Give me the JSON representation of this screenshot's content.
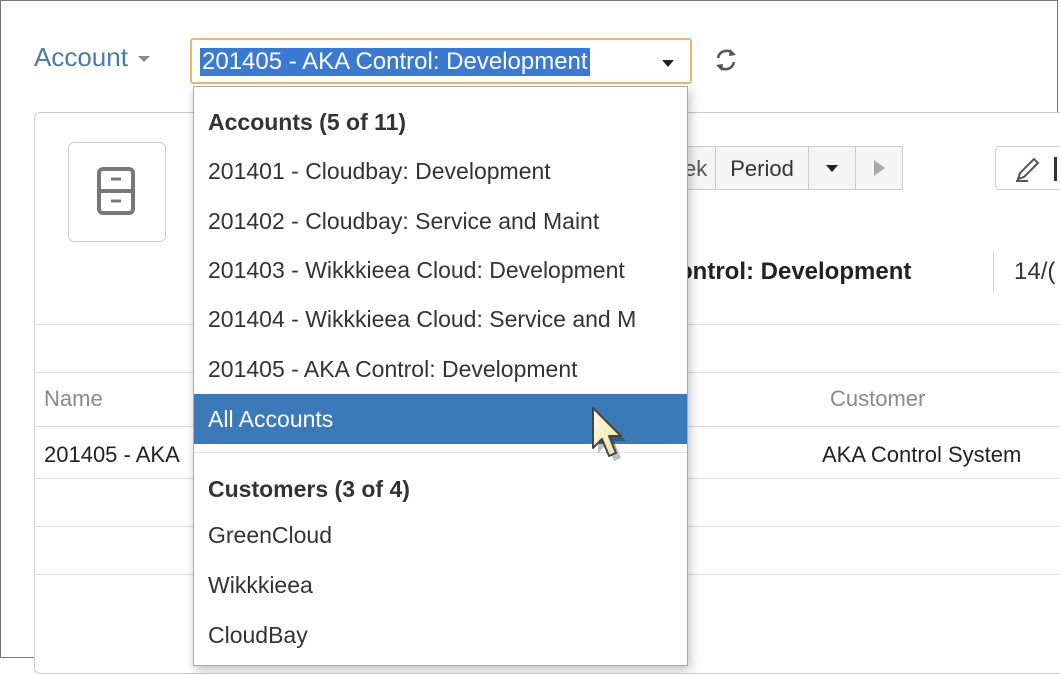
{
  "account": {
    "label": "Account",
    "selected_value": "201405 - AKA Control: Development"
  },
  "toolbar": {
    "week_partial": "ek",
    "period_label": "Period"
  },
  "header": {
    "title_partial": "ontrol: Development",
    "date_partial": "14/("
  },
  "table": {
    "columns": [
      "Name",
      "Customer"
    ],
    "rows": [
      {
        "name": "201405 - AKA",
        "customer": "AKA Control System"
      }
    ]
  },
  "dropdown": {
    "accounts_header": "Accounts (5 of 11)",
    "accounts": [
      "201401 - Cloudbay: Development",
      "201402 - Cloudbay: Service and Maint",
      "201403 - Wikkkieea Cloud: Development",
      "201404 - Wikkkieea Cloud: Service and M",
      "201405 - AKA Control: Development"
    ],
    "all_accounts": "All Accounts",
    "customers_header": "Customers (3 of 4)",
    "customers": [
      "GreenCloud",
      "Wikkkieea",
      "CloudBay"
    ]
  },
  "colors": {
    "link": "#4a78b0",
    "selection": "#3a7ad0",
    "active_item": "#3b79b8",
    "focus_border": "#e3b96a"
  },
  "icons": [
    "caret-down-icon",
    "refresh-icon",
    "cabinet-icon",
    "play-icon",
    "pencil-icon",
    "mouse-cursor-icon"
  ]
}
